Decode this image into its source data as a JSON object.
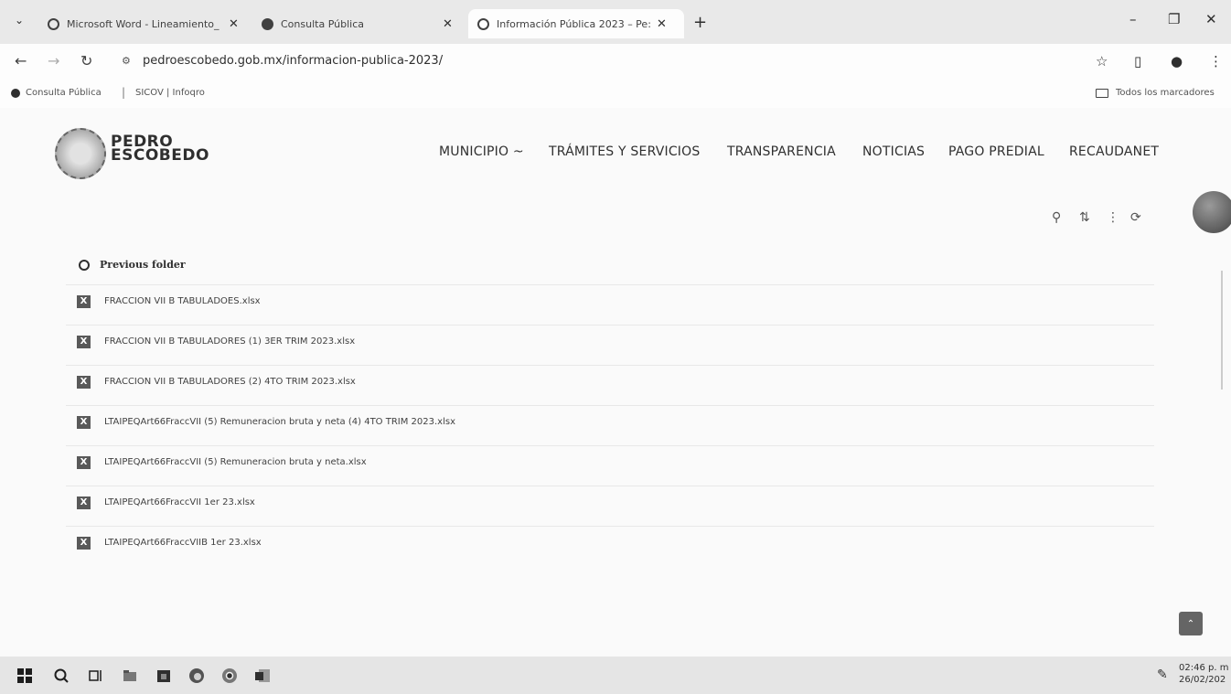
{
  "browser": {
    "tabs": [
      {
        "title": "Microsoft Word - Lineamiento_"
      },
      {
        "title": "Consulta Pública"
      },
      {
        "title": "Información Pública 2023 – Pe:"
      }
    ],
    "url": "pedroescobedo.gob.mx/informacion-publica-2023/",
    "bookmarks": [
      "Consulta Pública",
      "SICOV | Infoqro"
    ],
    "bookmarks_folder": "Todos los marcadores"
  },
  "site": {
    "logo_line1": "PEDRO",
    "logo_line2": "ESCOBEDO",
    "menu": [
      "MUNICIPIO ~",
      "TRÁMITES Y SERVICIOS",
      "TRANSPARENCIA",
      "NOTICIAS",
      "PAGO PREDIAL",
      "RECAUDANET"
    ]
  },
  "files": {
    "previous_folder": "Previous folder",
    "items": [
      "FRACCION VII B TABULADOES.xlsx",
      "FRACCION VII B TABULADORES (1) 3ER TRIM 2023.xlsx",
      "FRACCION VII B TABULADORES (2) 4TO TRIM 2023.xlsx",
      "LTAIPEQArt66FraccVII (5) Remuneracion bruta y neta (4) 4TO TRIM 2023.xlsx",
      "LTAIPEQArt66FraccVII (5) Remuneracion bruta y neta.xlsx",
      "LTAIPEQArt66FraccVII 1er 23.xlsx",
      "LTAIPEQArt66FraccVIIB 1er 23.xlsx"
    ]
  },
  "taskbar": {
    "time": "02:46 p. m",
    "date": "26/02/202"
  }
}
